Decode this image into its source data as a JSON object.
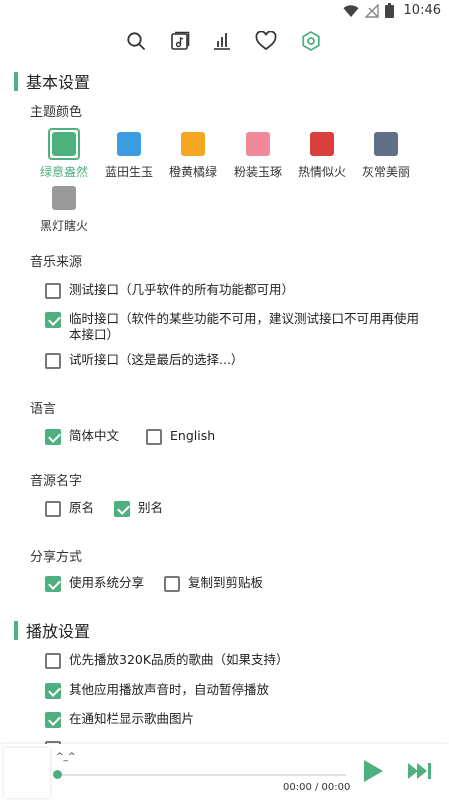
{
  "status": {
    "time": "10:46"
  },
  "colors": {
    "accent": "#4fb07f"
  },
  "toolbar": {
    "icons": [
      "search-icon",
      "music-library-icon",
      "leaderboard-icon",
      "favorite-icon",
      "settings-icon"
    ],
    "active": "settings-icon"
  },
  "basic": {
    "title": "基本设置",
    "theme": {
      "label": "主题颜色",
      "items": [
        {
          "name": "绿意盎然",
          "color": "#4fb07f",
          "active": true
        },
        {
          "name": "蓝田生玉",
          "color": "#3a9de0"
        },
        {
          "name": "橙黄橘绿",
          "color": "#f5a623"
        },
        {
          "name": "粉装玉琢",
          "color": "#f08a9a"
        },
        {
          "name": "热情似火",
          "color": "#d9403c"
        },
        {
          "name": "灰常美丽",
          "color": "#617086"
        },
        {
          "name": "黑灯瞎火",
          "color": "#9a9a9a"
        }
      ]
    },
    "source": {
      "label": "音乐来源",
      "options": [
        {
          "text": "测试接口（几乎软件的所有功能都可用）",
          "checked": false
        },
        {
          "text": "临时接口（软件的某些功能不可用，建议测试接口不可用再使用本接口）",
          "checked": true
        },
        {
          "text": "试听接口（这是最后的选择...）",
          "checked": false
        }
      ]
    },
    "language": {
      "label": "语言",
      "options": [
        {
          "text": "简体中文",
          "checked": true
        },
        {
          "text": "English",
          "checked": false
        }
      ]
    },
    "source_name": {
      "label": "音源名字",
      "options": [
        {
          "text": "原名",
          "checked": false
        },
        {
          "text": "别名",
          "checked": true
        }
      ]
    },
    "share": {
      "label": "分享方式",
      "options": [
        {
          "text": "使用系统分享",
          "checked": true
        },
        {
          "text": "复制到剪贴板",
          "checked": false
        }
      ]
    }
  },
  "playback": {
    "title": "播放设置",
    "options": [
      {
        "text": "优先播放320K品质的歌曲（如果支持）",
        "checked": false
      },
      {
        "text": "其他应用播放声音时，自动暂停播放",
        "checked": true
      },
      {
        "text": "在通知栏显示歌曲图片",
        "checked": true
      }
    ]
  },
  "player": {
    "song": "^_^",
    "time": "00:00 / 00:00"
  }
}
